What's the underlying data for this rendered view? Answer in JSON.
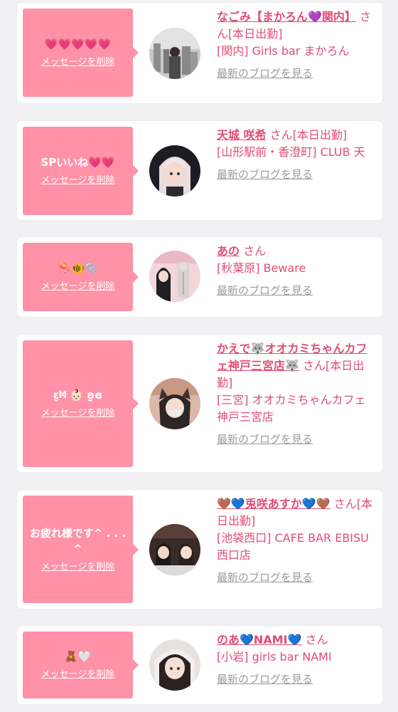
{
  "cards": [
    {
      "message": "💗💗💗💗💗",
      "delete_label": "メッセージを削除",
      "name": "なごみ【まかろん💜関内】",
      "san": "さん",
      "status": "[本日出勤]",
      "shop": "[関内] Girls bar まかろん",
      "blog_label": "最新のブログを見る"
    },
    {
      "message": "SPいいね💗💗",
      "delete_label": "メッセージを削除",
      "name": "天城 咲希",
      "san": "さん",
      "status": "[本日出勤]",
      "shop": "[山形駅前・香澄町] CLUB 天",
      "blog_label": "最新のブログを見る"
    },
    {
      "message": "🪼🐠🫧",
      "delete_label": "メッセージを削除",
      "name": "あの",
      "san": "さん",
      "status": "",
      "shop": "[秋葉原] Beware",
      "blog_label": "最新のブログを見る"
    },
    {
      "message": "ɛ̤̬ᢂ 👶🏻 ʚ̤̫ɞ",
      "delete_label": "メッセージを削除",
      "name": "かえで🐺オオカミちゃんカフェ神戸三宮店🐺",
      "san": "さん",
      "status": "[本日出勤]",
      "shop": "[三宮] オオカミちゃんカフェ神戸三宮店",
      "blog_label": "最新のブログを見る"
    },
    {
      "message": "お疲れ様です^ . . .^",
      "delete_label": "メッセージを削除",
      "name": "🤎💙兎咲あすか💙🤎",
      "san": "さん",
      "status": "[本日出勤]",
      "shop": "[池袋西口] CAFE BAR EBISU 西口店",
      "blog_label": "最新のブログを見る"
    },
    {
      "message": "🧸🤍",
      "delete_label": "メッセージを削除",
      "name": "のあ💙NAMI💙",
      "san": "さん",
      "status": "",
      "shop": "[小岩] girls bar NAMI",
      "blog_label": "最新のブログを見る"
    }
  ]
}
